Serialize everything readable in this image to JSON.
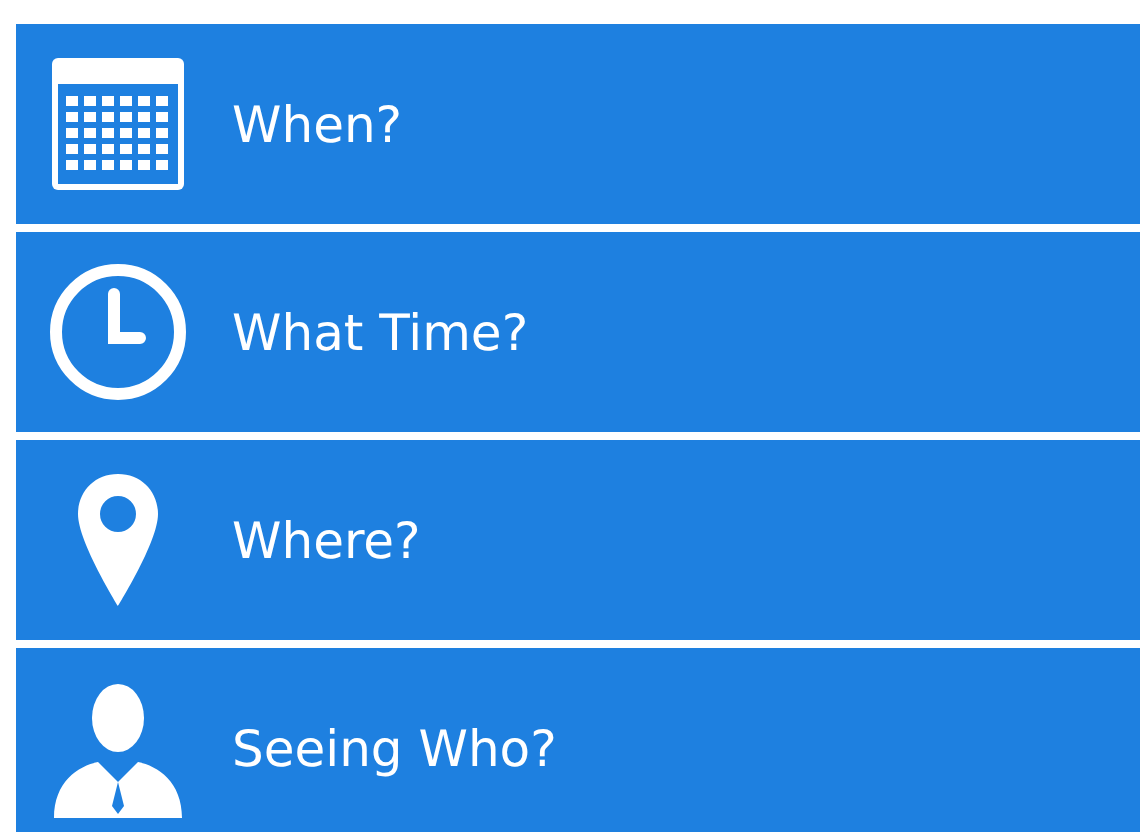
{
  "menu": {
    "items": [
      {
        "label": "When?",
        "kind": "calendar"
      },
      {
        "label": "What Time?",
        "kind": "clock"
      },
      {
        "label": "Where?",
        "kind": "location"
      },
      {
        "label": "Seeing Who?",
        "kind": "person"
      }
    ]
  }
}
